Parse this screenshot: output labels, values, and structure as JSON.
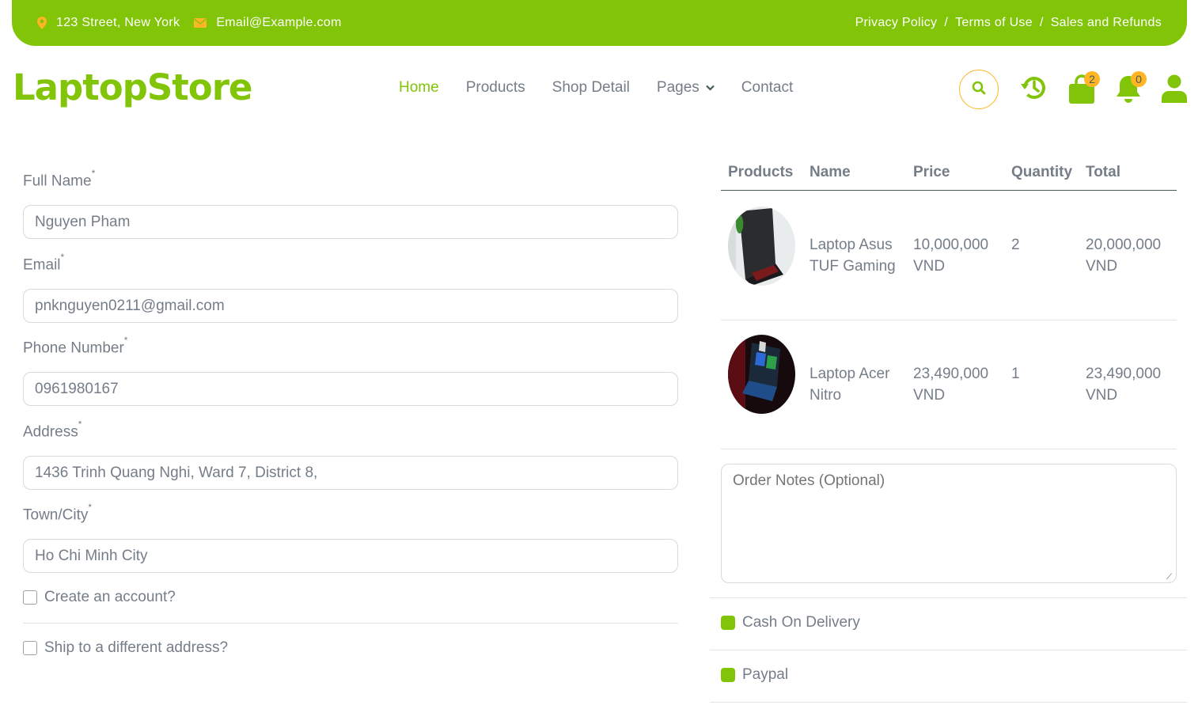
{
  "topbar": {
    "address": "123 Street, New York",
    "email": "Email@Example.com",
    "links": [
      "Privacy Policy",
      "Terms of Use",
      "Sales and Refunds"
    ],
    "separator": "/"
  },
  "header": {
    "logo": "LaptopStore",
    "nav": [
      {
        "label": "Home",
        "active": true
      },
      {
        "label": "Products",
        "active": false
      },
      {
        "label": "Shop Detail",
        "active": false
      },
      {
        "label": "Pages",
        "active": false,
        "dropdown": true
      },
      {
        "label": "Contact",
        "active": false
      }
    ],
    "icons": [
      "search-icon",
      "history-icon",
      "shopping-bag-icon",
      "bell-icon",
      "user-icon"
    ],
    "cart_count": "2",
    "notification_count": "0"
  },
  "form": {
    "fields": [
      {
        "label": "Full Name",
        "required": "*",
        "value": "Nguyen Pham"
      },
      {
        "label": "Email",
        "required": "*",
        "value": "pnknguyen0211@gmail.com"
      },
      {
        "label": "Phone Number",
        "required": "*",
        "value": "0961980167"
      },
      {
        "label": "Address",
        "required": "*",
        "value": "1436 Trinh Quang Nghi, Ward 7, District 8,"
      },
      {
        "label": "Town/City",
        "required": "*",
        "value": "Ho Chi Minh City"
      }
    ],
    "create_account": "Create an account?",
    "ship_different": "Ship to a different address?"
  },
  "order": {
    "headers": [
      "Products",
      "Name",
      "Price",
      "Quantity",
      "Total"
    ],
    "items": [
      {
        "name_line1": "Laptop Asus",
        "name_line2": "TUF Gaming",
        "price": "10,000,000",
        "price_unit": "VND",
        "quantity": "2",
        "total": "20,000,000",
        "total_unit": "VND"
      },
      {
        "name_line1": "Laptop Acer",
        "name_line2": "Nitro",
        "price": "23,490,000",
        "price_unit": "VND",
        "quantity": "1",
        "total": "23,490,000",
        "total_unit": "VND"
      }
    ],
    "notes_placeholder": "Order Notes (Optional)"
  },
  "payment": {
    "options": [
      "Cash On Delivery",
      "Paypal"
    ]
  },
  "colors": {
    "brand": "#81c408",
    "accent": "#ffb524",
    "text": "#747d88"
  }
}
